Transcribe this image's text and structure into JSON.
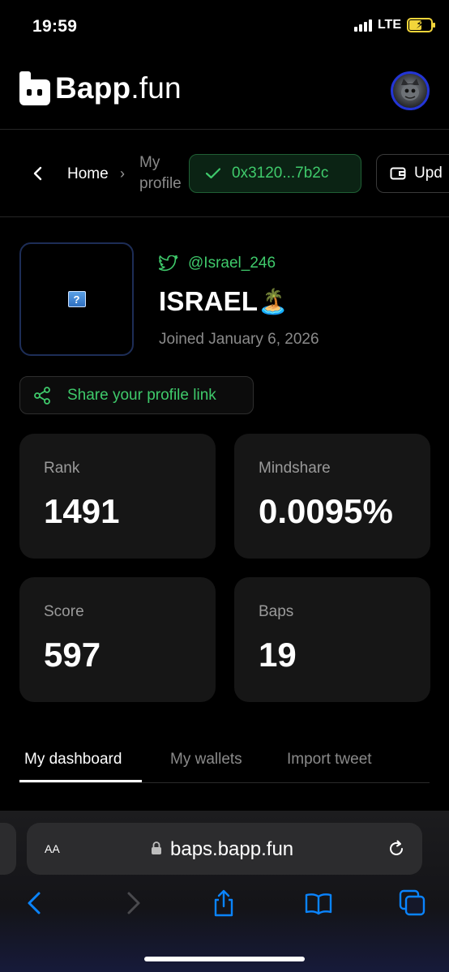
{
  "status_bar": {
    "time": "19:59",
    "network": "LTE"
  },
  "header": {
    "logo_bold": "Bapp",
    "logo_suffix": ".fun"
  },
  "breadcrumb": {
    "home": "Home",
    "separator": "›",
    "current_line1": "My",
    "current_line2": "profile"
  },
  "wallet": {
    "address": "0x3120...7b2c",
    "update_label": "Upd"
  },
  "profile": {
    "twitter_handle": "@Israel_246",
    "name": "ISRAEL",
    "name_emoji": "🏝️",
    "joined": "Joined January 6, 2026",
    "share_label": "Share your profile link",
    "broken_image_glyph": "?"
  },
  "stats": {
    "rank": {
      "label": "Rank",
      "value": "1491"
    },
    "mindshare": {
      "label": "Mindshare",
      "value": "0.0095%"
    },
    "score": {
      "label": "Score",
      "value": "597"
    },
    "baps": {
      "label": "Baps",
      "value": "19"
    }
  },
  "tabs": [
    {
      "label": "My dashboard",
      "active": true
    },
    {
      "label": "My wallets",
      "active": false
    },
    {
      "label": "Import tweet",
      "active": false
    }
  ],
  "browser": {
    "text_size_label": "AA",
    "url": "baps.bapp.fun"
  },
  "colors": {
    "accent_green": "#3fca6b",
    "background": "#000000",
    "card": "#161616",
    "avatar_ring": "#2335d6",
    "ios_blue": "#0a84ff"
  }
}
